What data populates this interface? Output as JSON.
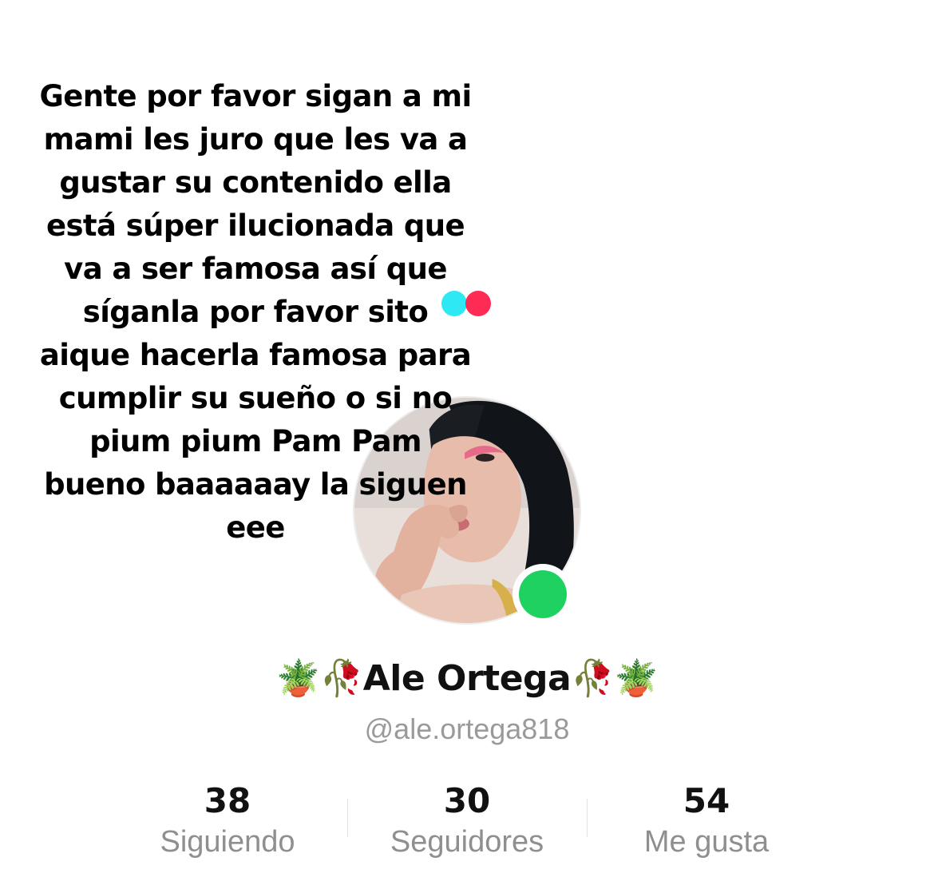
{
  "caption": {
    "lines": [
      "Gente por favor sigan a mi",
      "mami les juro que les va a",
      "gustar su contenido ella",
      "está súper ilucionada que",
      "va a ser famosa así que",
      "síganla por favor sito",
      "aique hacerla famosa para",
      "cumplir su sueño o si no",
      "pium pium Pam Pam",
      "bueno baaaaaay la siguen",
      "eee"
    ]
  },
  "profile": {
    "display_name": "🪴🥀Ale Ortega🥀🪴",
    "handle": "@ale.ortega818",
    "online_status_color": "#1fd160",
    "avatar": "profile-photo"
  },
  "logo": {
    "name": "tiktok-dots-icon",
    "colors": [
      "#2ee8f4",
      "#fe2c55"
    ]
  },
  "stats": [
    {
      "value": "38",
      "label": "Siguiendo"
    },
    {
      "value": "30",
      "label": "Seguidores"
    },
    {
      "value": "54",
      "label": "Me gusta"
    }
  ]
}
